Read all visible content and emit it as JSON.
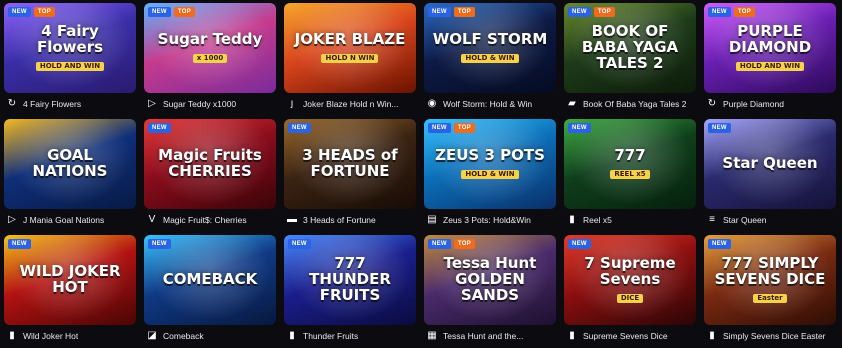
{
  "badges": {
    "new": "NEW",
    "top": "TOP"
  },
  "games": [
    {
      "name": "4 Fairy Flowers",
      "logo": "4 Fairy Flowers",
      "sub": "HOLD AND WIN",
      "badges": [
        "new",
        "top"
      ],
      "provider_icon": "spiral-icon",
      "glyph": "↻",
      "colors": [
        "#3a2ea8",
        "#8f63ff",
        "#2a1a6e"
      ]
    },
    {
      "name": "Sugar Teddy x1000",
      "logo": "Sugar Teddy",
      "sub": "x 1000",
      "badges": [
        "new",
        "top"
      ],
      "provider_icon": "play-triangle-icon",
      "glyph": "▷",
      "colors": [
        "#c63b8e",
        "#5fb4ff",
        "#7a2b9a"
      ]
    },
    {
      "name": "Joker Blaze Hold n Win...",
      "logo": "JOKER BLAZE",
      "sub": "HOLD N WIN",
      "badges": [],
      "provider_icon": "hook-icon",
      "glyph": "ȷ",
      "colors": [
        "#d9451d",
        "#f7a72b",
        "#6b1200"
      ]
    },
    {
      "name": "Wolf Storm: Hold & Win",
      "logo": "WOLF STORM",
      "sub": "HOLD & WIN",
      "badges": [
        "new",
        "top"
      ],
      "provider_icon": "target-icon",
      "glyph": "◉",
      "colors": [
        "#0d1a45",
        "#2b6cc7",
        "#050b22"
      ]
    },
    {
      "name": "Book Of Baba Yaga Tales 2",
      "logo": "BOOK OF BABA YAGA TALES 2",
      "sub": "",
      "badges": [
        "new",
        "top"
      ],
      "provider_icon": "document-icon",
      "glyph": "▰",
      "colors": [
        "#1d3b19",
        "#6a8a2d",
        "#0c1a0a"
      ]
    },
    {
      "name": "Purple Diamond",
      "logo": "PURPLE DIAMOND",
      "sub": "HOLD AND WIN",
      "badges": [
        "new",
        "top"
      ],
      "provider_icon": "spiral-icon",
      "glyph": "↻",
      "colors": [
        "#6a1fb2",
        "#d25cff",
        "#2c0a5a"
      ]
    },
    {
      "name": "J Mania Goal Nations",
      "logo": "GOAL NATIONS",
      "sub": "",
      "badges": [],
      "provider_icon": "play-triangle-icon",
      "glyph": "▷",
      "colors": [
        "#0f2f7a",
        "#f5b922",
        "#081a45"
      ]
    },
    {
      "name": "Magic Fruit$: Cherries",
      "logo": "Magic Fruits CHERRIES",
      "sub": "",
      "badges": [
        "new"
      ],
      "provider_icon": "v-letter-icon",
      "glyph": "V",
      "colors": [
        "#8a0c1c",
        "#e53a3a",
        "#3a0409"
      ]
    },
    {
      "name": "3 Heads of Fortune",
      "logo": "3 HEADS of FORTUNE",
      "sub": "",
      "badges": [
        "new"
      ],
      "provider_icon": "hacksaw-icon",
      "glyph": "▬",
      "colors": [
        "#3b2313",
        "#9b6a2b",
        "#170c05"
      ]
    },
    {
      "name": "Zeus 3 Pots: Hold&Win",
      "logo": "ZEUS 3 POTS",
      "sub": "HOLD & WIN",
      "badges": [
        "new",
        "top"
      ],
      "provider_icon": "gamzix-icon",
      "glyph": "▤",
      "colors": [
        "#0b6fb8",
        "#35c3ff",
        "#0a2f6a"
      ]
    },
    {
      "name": "Reel x5",
      "logo": "777",
      "sub": "REEL x5",
      "badges": [
        "new"
      ],
      "provider_icon": "slot-machine-icon",
      "glyph": "▮",
      "colors": [
        "#0f3f1c",
        "#3fae43",
        "#06200c"
      ]
    },
    {
      "name": "Star Queen",
      "logo": "Star Queen",
      "sub": "",
      "badges": [
        "new"
      ],
      "provider_icon": "stack-icon",
      "glyph": "≡",
      "colors": [
        "#2a2a6e",
        "#a8a6ff",
        "#151238"
      ]
    },
    {
      "name": "Wild Joker Hot",
      "logo": "WILD JOKER HOT",
      "sub": "",
      "badges": [
        "new"
      ],
      "provider_icon": "slot-machine-icon",
      "glyph": "▮",
      "colors": [
        "#b31212",
        "#f5c518",
        "#4a0505"
      ]
    },
    {
      "name": "Comeback",
      "logo": "COMEBACK",
      "sub": "",
      "badges": [
        "new"
      ],
      "provider_icon": "card-icon",
      "glyph": "◪",
      "colors": [
        "#103a86",
        "#39c5ff",
        "#07183f"
      ]
    },
    {
      "name": "Thunder Fruits",
      "logo": "777 THUNDER FRUITS",
      "sub": "",
      "badges": [
        "new"
      ],
      "provider_icon": "slot-machine-icon",
      "glyph": "▮",
      "colors": [
        "#1b1e8c",
        "#4a8bff",
        "#0a0b40"
      ]
    },
    {
      "name": "Tessa Hunt and the...",
      "logo": "Tessa Hunt GOLDEN SANDS",
      "sub": "",
      "badges": [
        "new",
        "top"
      ],
      "provider_icon": "qr-grid-icon",
      "glyph": "▦",
      "colors": [
        "#4a2b6b",
        "#c58b3a",
        "#1e1030"
      ]
    },
    {
      "name": "Supreme Sevens Dice",
      "logo": "7 Supreme Sevens",
      "sub": "DICE",
      "badges": [
        "new"
      ],
      "provider_icon": "slot-machine-icon",
      "glyph": "▮",
      "colors": [
        "#8c0f0f",
        "#e23b2a",
        "#2b0505"
      ]
    },
    {
      "name": "Simply Sevens Dice Easter",
      "logo": "777 SIMPLY SEVENS DICE",
      "sub": "Easter",
      "badges": [
        "new"
      ],
      "provider_icon": "slot-machine-icon",
      "glyph": "▮",
      "colors": [
        "#7a2a12",
        "#e8a03a",
        "#2e0d04"
      ]
    }
  ]
}
